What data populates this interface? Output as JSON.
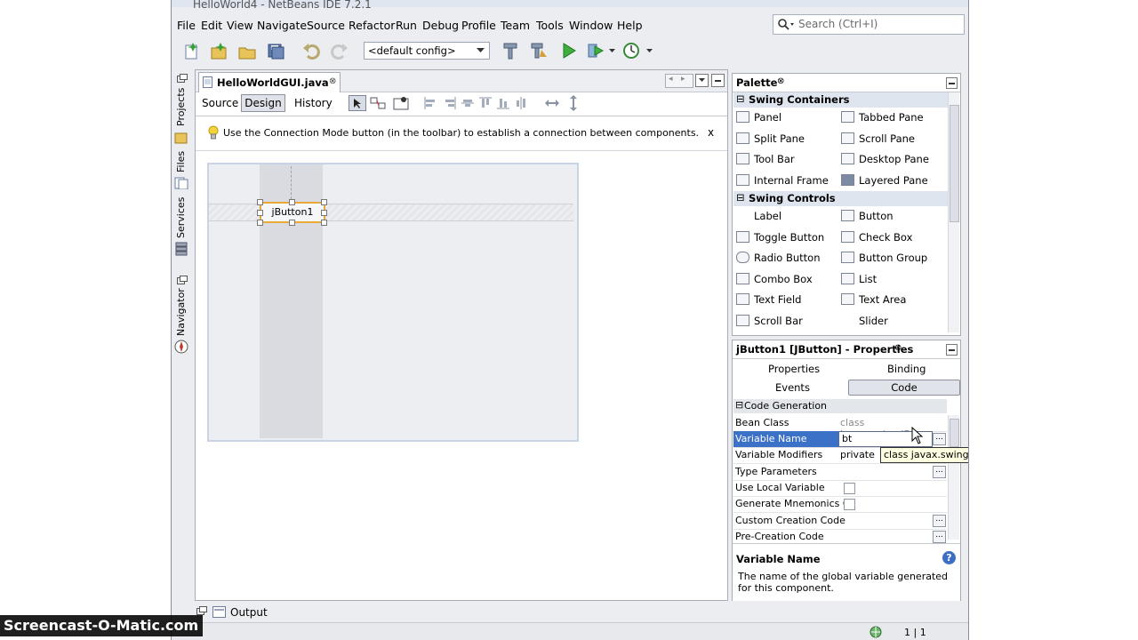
{
  "window": {
    "title": "HelloWorld4 - NetBeans IDE 7.2.1"
  },
  "menu": [
    "File",
    "Edit",
    "View",
    "Navigate",
    "Source",
    "Refactor",
    "Run",
    "Debug",
    "Profile",
    "Team",
    "Tools",
    "Window",
    "Help"
  ],
  "search": {
    "placeholder": "Search (Ctrl+I)"
  },
  "toolbar": {
    "config": "<default config>"
  },
  "side_tabs": [
    "Projects",
    "Files",
    "Services",
    "Navigator"
  ],
  "editor": {
    "file_tab": "HelloWorldGUI.java",
    "view_tabs": [
      "Source",
      "Design",
      "History"
    ],
    "hint": "Use the Connection Mode button (in the toolbar) to establish a connection between components.",
    "hint_close": "x",
    "button_label": "jButton1"
  },
  "palette": {
    "title": "Palette",
    "categories": [
      {
        "name": "Swing Containers",
        "items": [
          "Panel",
          "Tabbed Pane",
          "Split Pane",
          "Scroll Pane",
          "Tool Bar",
          "Desktop Pane",
          "Internal Frame",
          "Layered Pane"
        ]
      },
      {
        "name": "Swing Controls",
        "items": [
          "Label",
          "Button",
          "Toggle Button",
          "Check Box",
          "Radio Button",
          "Button Group",
          "Combo Box",
          "List",
          "Text Field",
          "Text Area",
          "Scroll Bar",
          "Slider"
        ]
      }
    ]
  },
  "properties": {
    "title": "jButton1 [JButton] - Properties",
    "tabs": [
      "Properties",
      "Binding",
      "Events",
      "Code"
    ],
    "section": "Code Generation",
    "rows": [
      {
        "name": "Bean Class",
        "value": "class javax.swing.JB..."
      },
      {
        "name": "Variable Name",
        "value": "bt"
      },
      {
        "name": "Variable Modifiers",
        "value": "private"
      },
      {
        "name": "Type Parameters",
        "value": ""
      },
      {
        "name": "Use Local Variable",
        "value": ""
      },
      {
        "name": "Generate Mnemonics Co",
        "value": ""
      },
      {
        "name": "Custom Creation Code",
        "value": ""
      },
      {
        "name": "Pre-Creation Code",
        "value": ""
      }
    ],
    "tooltip": "class javax.swing.J",
    "desc_title": "Variable Name",
    "desc_text": "The name of the global variable generated for this component."
  },
  "bottom": {
    "output_label": "Output",
    "position": "1 | 1"
  },
  "watermark": "Screencast-O-Matic.com"
}
